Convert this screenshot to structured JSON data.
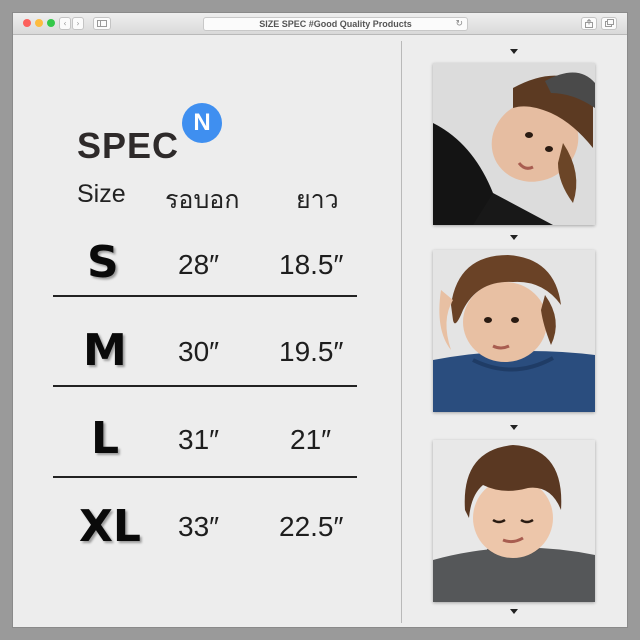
{
  "window": {
    "title": "SIZE SPEC #Good Quality Products",
    "back": "‹",
    "forward": "›"
  },
  "spec": {
    "title": "SPEC",
    "badge": "N",
    "headers": {
      "size": "Size",
      "chest": "รอบอก",
      "length": "ยาว"
    },
    "rows": [
      {
        "size": "S",
        "chest": "28″",
        "length": "18.5″"
      },
      {
        "size": "M",
        "chest": "30″",
        "length": "19.5″"
      },
      {
        "size": "L",
        "chest": "31″",
        "length": "21″"
      },
      {
        "size": "XL",
        "chest": "33″",
        "length": "22.5″"
      }
    ]
  },
  "icons": {
    "reload": "reload-icon",
    "share": "share-icon",
    "tabs": "tabs-icon",
    "sidebar": "sidebar-icon",
    "scroll_marker": "triangle-down-icon"
  },
  "colors": {
    "badge": "#3f8ff0",
    "close": "#fc605c",
    "minimize": "#fdbc40",
    "zoom": "#34c84a"
  }
}
